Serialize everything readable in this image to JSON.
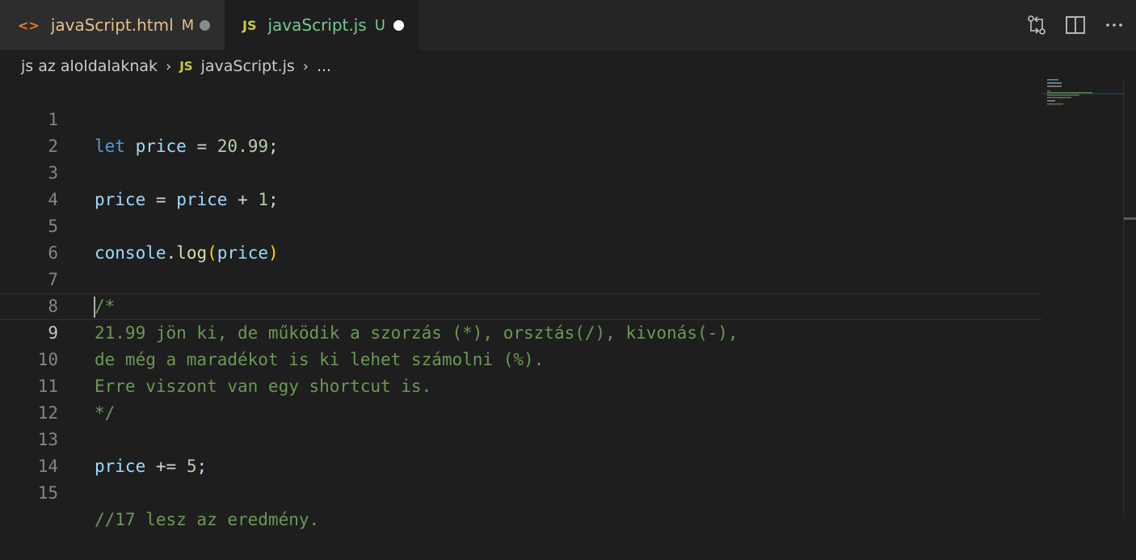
{
  "tabs": [
    {
      "icon": "<>",
      "name": "javaScript.html",
      "status": "M",
      "active": false
    },
    {
      "icon": "JS",
      "name": "javaScript.js",
      "status": "U",
      "active": true
    }
  ],
  "breadcrumb": {
    "folder": "js az aloldalaknak",
    "file_icon": "JS",
    "file": "javaScript.js",
    "more": "..."
  },
  "editor": {
    "current_line": 9,
    "line_numbers": [
      "1",
      "2",
      "3",
      "4",
      "5",
      "6",
      "7",
      "8",
      "9",
      "10",
      "11",
      "12",
      "13",
      "14",
      "15"
    ]
  },
  "colors": {
    "keyword": "#569cd6",
    "variable": "#9cdcfe",
    "number": "#b5cea8",
    "function": "#dcdcaa",
    "bracket": "#ffd700",
    "comment": "#6a9955"
  },
  "icons": {
    "html_tab": "html-file-icon",
    "js_tab": "js-file-icon",
    "open_changes": "open-changes-icon",
    "split_editor": "split-editor-icon",
    "more_actions": "more-actions-icon"
  }
}
